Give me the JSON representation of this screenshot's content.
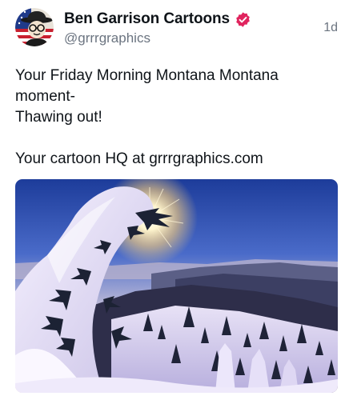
{
  "post": {
    "author": {
      "name": "Ben Garrison Cartoons",
      "handle": "@grrrgraphics",
      "verified": true,
      "avatar_icon": "cartoon-avatar-icon",
      "verified_icon": "verified-badge-icon",
      "verified_color": "#e0245e"
    },
    "timestamp": "1d",
    "text_lines": [
      "Your Friday Morning Montana Montana",
      "moment-",
      "Thawing out!",
      "",
      "Your cartoon HQ at grrrgraphics.com"
    ],
    "media": {
      "type": "photo",
      "icon": "snowy-mountain-sunburst-photo"
    }
  },
  "colors": {
    "text_primary": "#0f1419",
    "text_secondary": "#6b7480",
    "sky_top": "#1d3c9a",
    "sky_horizon": "#f6b35e",
    "snow": "#f4f1fb"
  }
}
